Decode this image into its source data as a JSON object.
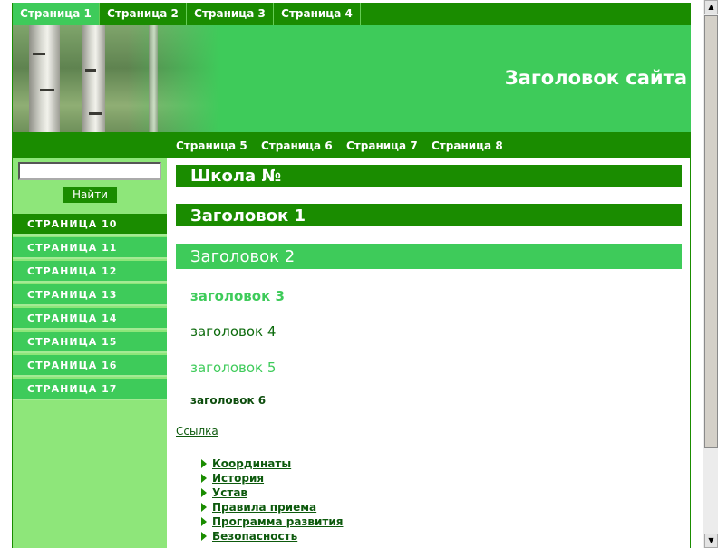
{
  "top_nav": {
    "items": [
      "Страница 1",
      "Страница 2",
      "Страница 3",
      "Страница 4"
    ]
  },
  "header": {
    "site_title": "Заголовок сайта"
  },
  "sub_nav": {
    "items": [
      "Страница 5",
      "Страница 6",
      "Страница 7",
      "Страница 8"
    ]
  },
  "search": {
    "value": "",
    "button_label": "Найти"
  },
  "sidebar": {
    "items": [
      "СТРАНИЦА 10",
      "СТРАНИЦА 11",
      "СТРАНИЦА 12",
      "СТРАНИЦА 13",
      "СТРАНИЦА 14",
      "СТРАНИЦА 15",
      "СТРАНИЦА 16",
      "СТРАНИЦА 17"
    ]
  },
  "content": {
    "school_title": "Школа №",
    "h1": "Заголовок 1",
    "h2": "Заголовок 2",
    "h3": "заголовок 3",
    "h4": "заголовок 4",
    "h5": "заголовок 5",
    "h6": "заголовок 6",
    "link": "Ссылка",
    "links": [
      "Координаты",
      "История",
      "Устав",
      "Правила приема",
      "Программа развития",
      "Безопасность"
    ]
  },
  "colors": {
    "dark_green": "#1a8c00",
    "mid_green": "#3ecb5a",
    "light_green": "#8ee67a"
  }
}
